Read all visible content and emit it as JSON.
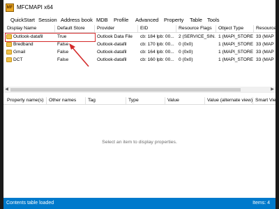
{
  "window": {
    "title": "MFCMAPI x64",
    "icon_label": "MF"
  },
  "menu": [
    "QuickStart",
    "Session",
    "Address book",
    "MDB",
    "Profile",
    "Advanced",
    "Property",
    "Table",
    "Tools"
  ],
  "content_table": {
    "columns": [
      "Display Name",
      "Default Store",
      "Provider",
      "EID",
      "Resource Flags",
      "Object Type",
      "Resource"
    ],
    "rows": [
      {
        "name": "Outlook-datafil",
        "default": "True",
        "provider": "Outlook Data File",
        "eid": "cb: 184 lpb: 00...",
        "flags": "2 (SERVICE_SIN...",
        "type": "1 (MAPI_STORE)",
        "res": "33 (MAP"
      },
      {
        "name": "Bredband",
        "default": "False",
        "provider": "Outlook-datafil",
        "eid": "cb: 170 lpb: 00...",
        "flags": "0 (0x0)",
        "type": "1 (MAPI_STORE)",
        "res": "33 (MAP"
      },
      {
        "name": "Gmail",
        "default": "False",
        "provider": "Outlook-datafil",
        "eid": "cb: 164 lpb: 00...",
        "flags": "0 (0x0)",
        "type": "1 (MAPI_STORE)",
        "res": "33 (MAP"
      },
      {
        "name": "DCT",
        "default": "False",
        "provider": "Outlook-datafil",
        "eid": "cb: 160 lpb: 00...",
        "flags": "0 (0x0)",
        "type": "1 (MAPI_STORE)",
        "res": "33 (MAP"
      }
    ]
  },
  "property_table": {
    "columns": [
      "Property name(s)",
      "Other names",
      "Tag",
      "Type",
      "Value",
      "Value (alternate view)",
      "Smart Vie"
    ],
    "empty_message": "Select an item to display properties."
  },
  "status": {
    "left": "Contents table loaded",
    "right": "Items: 4"
  },
  "colors": {
    "status_bar": "#007acc",
    "highlight_box": "#d42a2a"
  }
}
